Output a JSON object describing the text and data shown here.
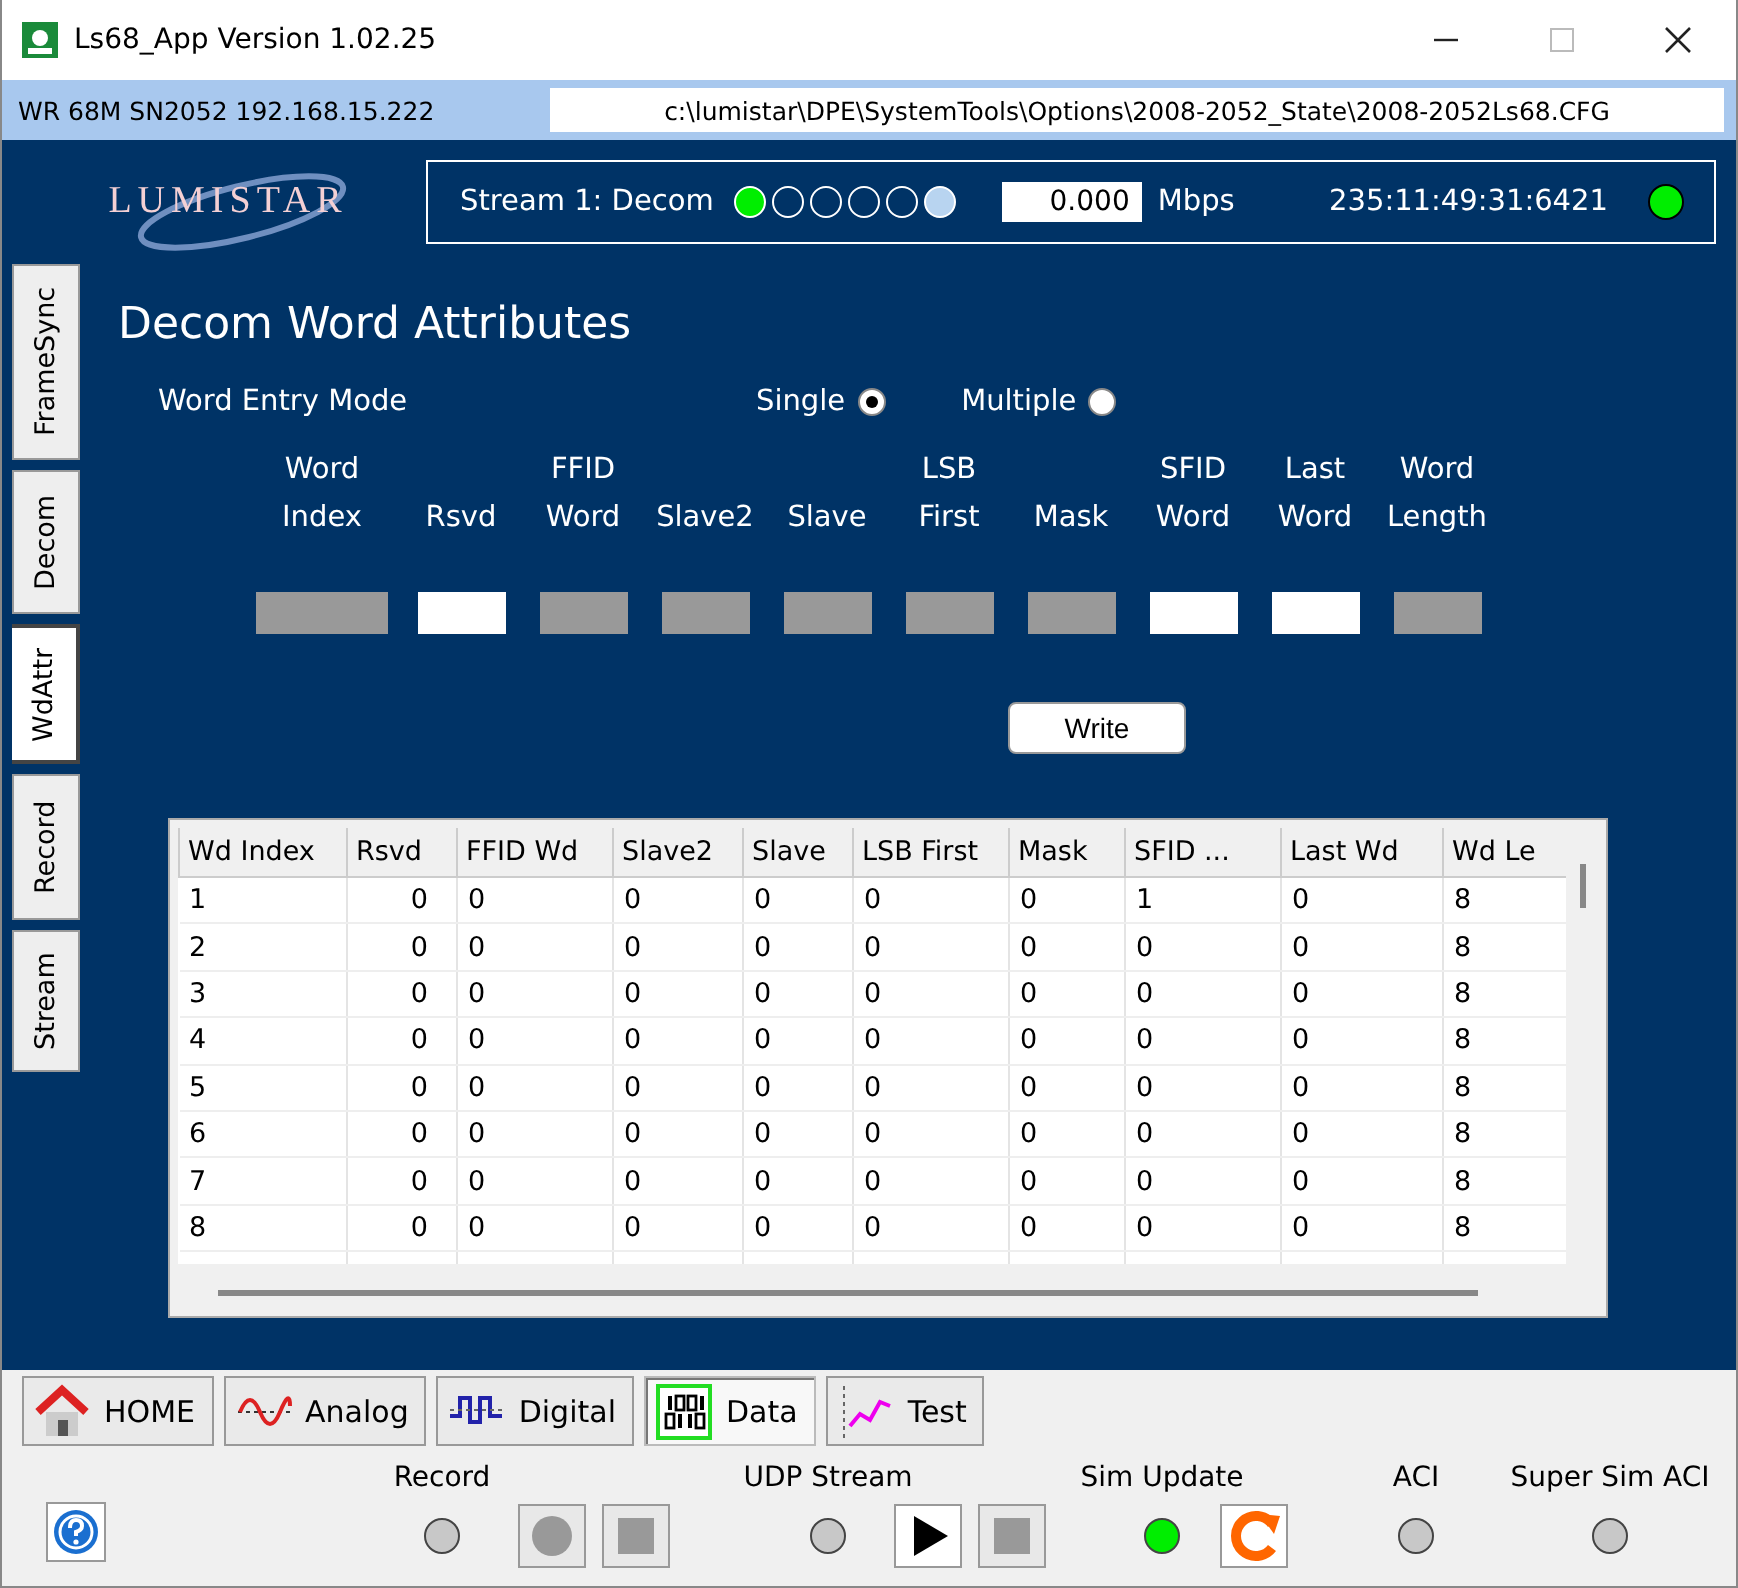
{
  "window": {
    "title": "Ls68_App Version 1.02.25"
  },
  "device_bar": {
    "device": "WR 68M SN2052  192.168.15.222",
    "config_path": "c:\\lumistar\\DPE\\SystemTools\\Options\\2008-2052_State\\2008-2052Ls68.CFG"
  },
  "logo": "LUMISTAR",
  "stream": {
    "label": "Stream 1: Decom",
    "leds": [
      {
        "lit": true,
        "color": "#00ee00"
      },
      {
        "lit": false
      },
      {
        "lit": false
      },
      {
        "lit": false
      },
      {
        "lit": false
      },
      {
        "lit": true,
        "color": "#b8d4f0"
      }
    ],
    "rate": "0.000",
    "unit": "Mbps",
    "time": "235:11:49:31:6421",
    "status_lit": true
  },
  "side_tabs": [
    {
      "label": "FrameSync",
      "selected": false
    },
    {
      "label": "Decom",
      "selected": false
    },
    {
      "label": "WdAttr",
      "selected": true
    },
    {
      "label": "Record",
      "selected": false
    },
    {
      "label": "Stream",
      "selected": false
    }
  ],
  "attributes": {
    "title": "Decom Word Attributes",
    "entry_mode_label": "Word Entry Mode",
    "modes": [
      {
        "label": "Single",
        "selected": true
      },
      {
        "label": "Multiple",
        "selected": false
      }
    ],
    "fields": [
      {
        "label": [
          "Word",
          "Index"
        ],
        "enabled": false
      },
      {
        "label": [
          "Rsvd"
        ],
        "enabled": true
      },
      {
        "label": [
          "FFID",
          "Word"
        ],
        "enabled": false
      },
      {
        "label": [
          "Slave2"
        ],
        "enabled": false
      },
      {
        "label": [
          "Slave"
        ],
        "enabled": false
      },
      {
        "label": [
          "LSB",
          "First"
        ],
        "enabled": false
      },
      {
        "label": [
          "Mask"
        ],
        "enabled": false
      },
      {
        "label": [
          "SFID",
          "Word"
        ],
        "enabled": true
      },
      {
        "label": [
          "Last",
          "Word"
        ],
        "enabled": true
      },
      {
        "label": [
          "Word",
          "Length"
        ],
        "enabled": false
      }
    ],
    "write_button": "Write"
  },
  "table": {
    "columns": [
      "Wd Index",
      "Rsvd",
      "FFID Wd",
      "Slave2",
      "Slave",
      "LSB First",
      "Mask",
      "SFID ...",
      "Last Wd",
      "Wd Le"
    ],
    "rows": [
      [
        "1",
        "0",
        "0",
        "0",
        "0",
        "0",
        "0",
        "1",
        "0",
        "8"
      ],
      [
        "2",
        "0",
        "0",
        "0",
        "0",
        "0",
        "0",
        "0",
        "0",
        "8"
      ],
      [
        "3",
        "0",
        "0",
        "0",
        "0",
        "0",
        "0",
        "0",
        "0",
        "8"
      ],
      [
        "4",
        "0",
        "0",
        "0",
        "0",
        "0",
        "0",
        "0",
        "0",
        "8"
      ],
      [
        "5",
        "0",
        "0",
        "0",
        "0",
        "0",
        "0",
        "0",
        "0",
        "8"
      ],
      [
        "6",
        "0",
        "0",
        "0",
        "0",
        "0",
        "0",
        "0",
        "0",
        "8"
      ],
      [
        "7",
        "0",
        "0",
        "0",
        "0",
        "0",
        "0",
        "0",
        "0",
        "8"
      ],
      [
        "8",
        "0",
        "0",
        "0",
        "0",
        "0",
        "0",
        "0",
        "0",
        "8"
      ]
    ]
  },
  "nav_tabs": [
    {
      "label": "HOME",
      "kind": "home",
      "selected": false
    },
    {
      "label": "Analog",
      "kind": "analog",
      "selected": false
    },
    {
      "label": "Digital",
      "kind": "digital",
      "selected": false
    },
    {
      "label": "Data",
      "kind": "data",
      "selected": true
    },
    {
      "label": "Test",
      "kind": "test",
      "selected": false
    }
  ],
  "controls": [
    {
      "label": "Record",
      "lit": false,
      "buttons": [
        {
          "kind": "record",
          "disabled": true
        },
        {
          "kind": "stop",
          "disabled": true
        }
      ]
    },
    {
      "label": "UDP Stream",
      "lit": false,
      "buttons": [
        {
          "kind": "play",
          "disabled": false
        },
        {
          "kind": "stop",
          "disabled": true
        }
      ]
    },
    {
      "label": "Sim Update",
      "lit": true,
      "buttons": [
        {
          "kind": "refresh",
          "disabled": false
        }
      ]
    },
    {
      "label": "ACI",
      "lit": false
    },
    {
      "label": "Super Sim ACI",
      "lit": false
    }
  ]
}
